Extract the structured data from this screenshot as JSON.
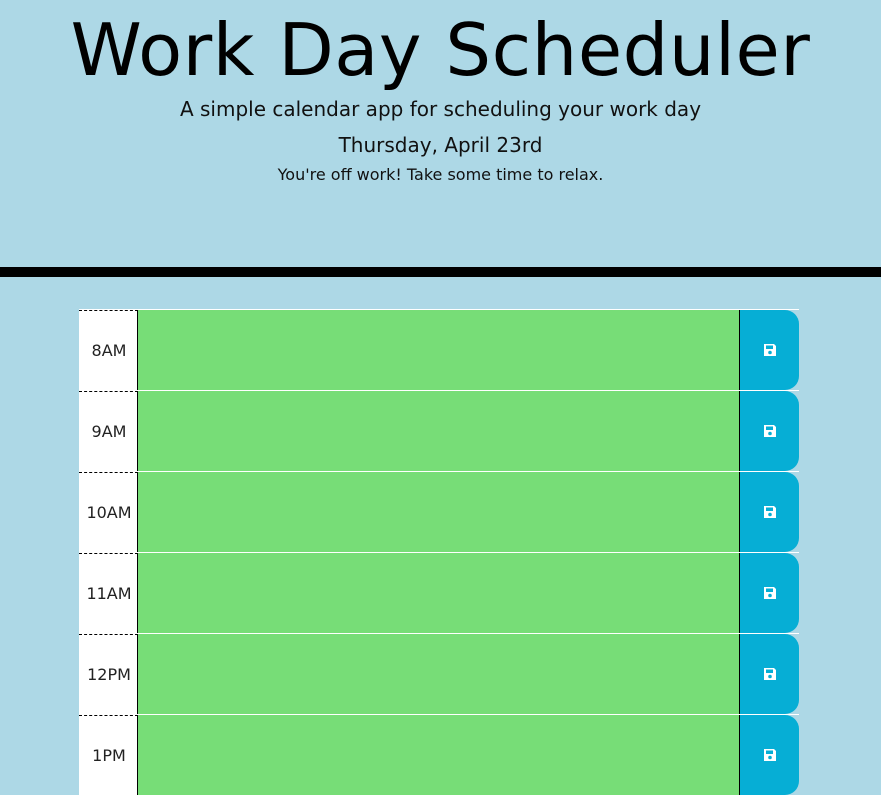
{
  "header": {
    "title": "Work Day Scheduler",
    "subtitle": "A simple calendar app for scheduling your work day",
    "date": "Thursday, April 23rd",
    "status": "You're off work! Take some time to relax."
  },
  "colors": {
    "background": "#add8e6",
    "future_block": "#77dd77",
    "save_button": "#06aed5",
    "divider": "#000000"
  },
  "schedule": {
    "rows": [
      {
        "hour": "8AM",
        "text": "",
        "save_icon": "save-icon"
      },
      {
        "hour": "9AM",
        "text": "",
        "save_icon": "save-icon"
      },
      {
        "hour": "10AM",
        "text": "",
        "save_icon": "save-icon"
      },
      {
        "hour": "11AM",
        "text": "",
        "save_icon": "save-icon"
      },
      {
        "hour": "12PM",
        "text": "",
        "save_icon": "save-icon"
      },
      {
        "hour": "1PM",
        "text": "",
        "save_icon": "save-icon"
      }
    ]
  }
}
